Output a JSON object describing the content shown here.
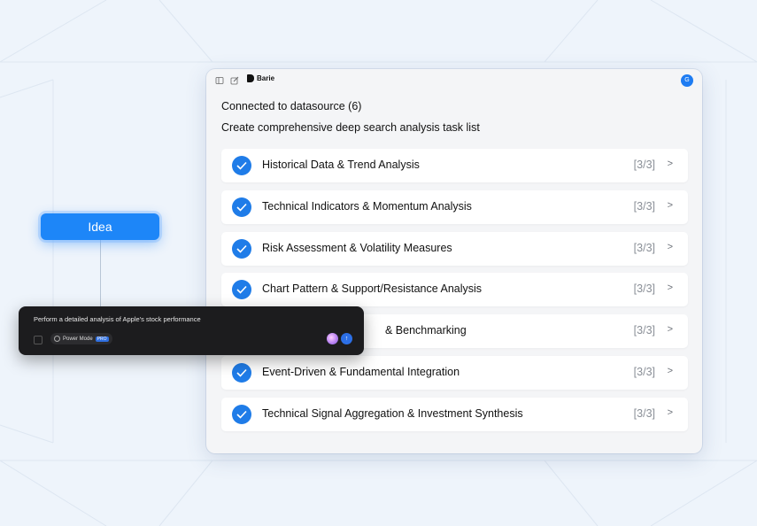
{
  "window": {
    "brand": "Barie",
    "avatar_initial": "G",
    "line1": "Connected to datasource (6)",
    "line2": "Create comprehensive deep search analysis task list"
  },
  "tasks": [
    {
      "label": "Historical Data & Trend Analysis",
      "count": "[3/3]"
    },
    {
      "label": "Technical Indicators & Momentum Analysis",
      "count": "[3/3]"
    },
    {
      "label": "Risk Assessment & Volatility Measures",
      "count": "[3/3]"
    },
    {
      "label": "Chart Pattern & Support/Resistance Analysis",
      "count": "[3/3]"
    },
    {
      "label": "& Benchmarking",
      "count": "[3/3]"
    },
    {
      "label": "Event-Driven & Fundamental Integration",
      "count": "[3/3]"
    },
    {
      "label": "Technical Signal Aggregation & Investment Synthesis",
      "count": "[3/3]"
    }
  ],
  "chevron": ">",
  "idea": {
    "label": "Idea"
  },
  "prompt": {
    "text": "Perform a detailed analysis of Apple's stock performance",
    "mode_label": "Power Mode",
    "mode_badge": "PRO"
  },
  "colors": {
    "accent": "#1f7ce8",
    "idea": "#1d86f8",
    "panel": "#1c1c1e"
  }
}
